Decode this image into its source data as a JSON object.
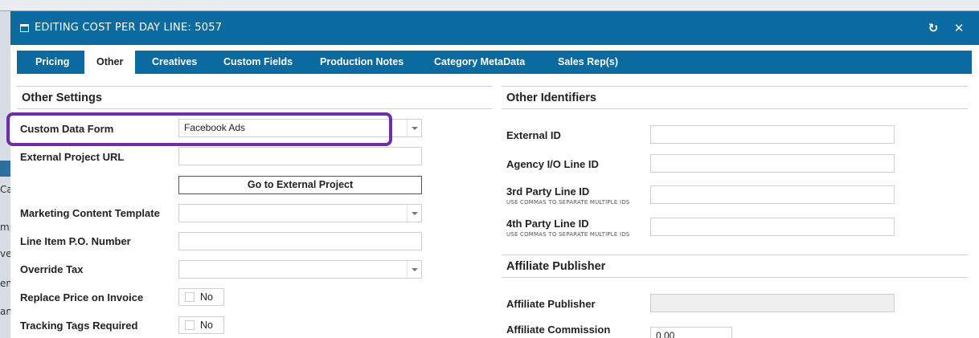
{
  "dialog": {
    "title": "EDITING COST PER DAY LINE: 5057",
    "refresh_icon": "refresh-icon",
    "close_icon": "close-icon"
  },
  "tabs": [
    {
      "label": "Pricing"
    },
    {
      "label": "Other",
      "active": true
    },
    {
      "label": "Creatives"
    },
    {
      "label": "Custom Fields"
    },
    {
      "label": "Production Notes"
    },
    {
      "label": "Category MetaData"
    },
    {
      "label": "Sales Rep(s)"
    }
  ],
  "other_settings": {
    "title": "Other Settings",
    "custom_data_form": {
      "label": "Custom Data Form",
      "value": "Facebook Ads"
    },
    "external_project_url": {
      "label": "External Project URL",
      "value": ""
    },
    "go_to_external_project": "Go to External Project",
    "marketing_content_template": {
      "label": "Marketing Content Template",
      "value": ""
    },
    "line_item_po_number": {
      "label": "Line Item P.O. Number",
      "value": ""
    },
    "override_tax": {
      "label": "Override Tax",
      "value": ""
    },
    "replace_price_on_invoice": {
      "label": "Replace Price on Invoice",
      "value": "No"
    },
    "tracking_tags_required": {
      "label": "Tracking Tags Required",
      "value": "No"
    }
  },
  "other_identifiers": {
    "title": "Other Identifiers",
    "external_id": {
      "label": "External ID",
      "value": ""
    },
    "agency_io_line_id": {
      "label": "Agency I/O Line ID",
      "value": ""
    },
    "third_party_line_id": {
      "label": "3rd Party Line ID",
      "hint": "USE COMMAS TO SEPARATE MULTIPLE IDS",
      "value": ""
    },
    "fourth_party_line_id": {
      "label": "4th Party Line ID",
      "hint": "USE COMMAS TO SEPARATE MULTIPLE IDS",
      "value": ""
    }
  },
  "affiliate_publisher": {
    "title": "Affiliate Publisher",
    "publisher": {
      "label": "Affiliate Publisher",
      "value": ""
    },
    "commission": {
      "label": "Affiliate Commission",
      "value": "0.00"
    }
  },
  "background_fragments": [
    "Ca",
    "mp",
    "ve",
    "en",
    "and"
  ],
  "colors": {
    "titlebar": "#0b6aa0",
    "highlight": "#6f2da8"
  }
}
